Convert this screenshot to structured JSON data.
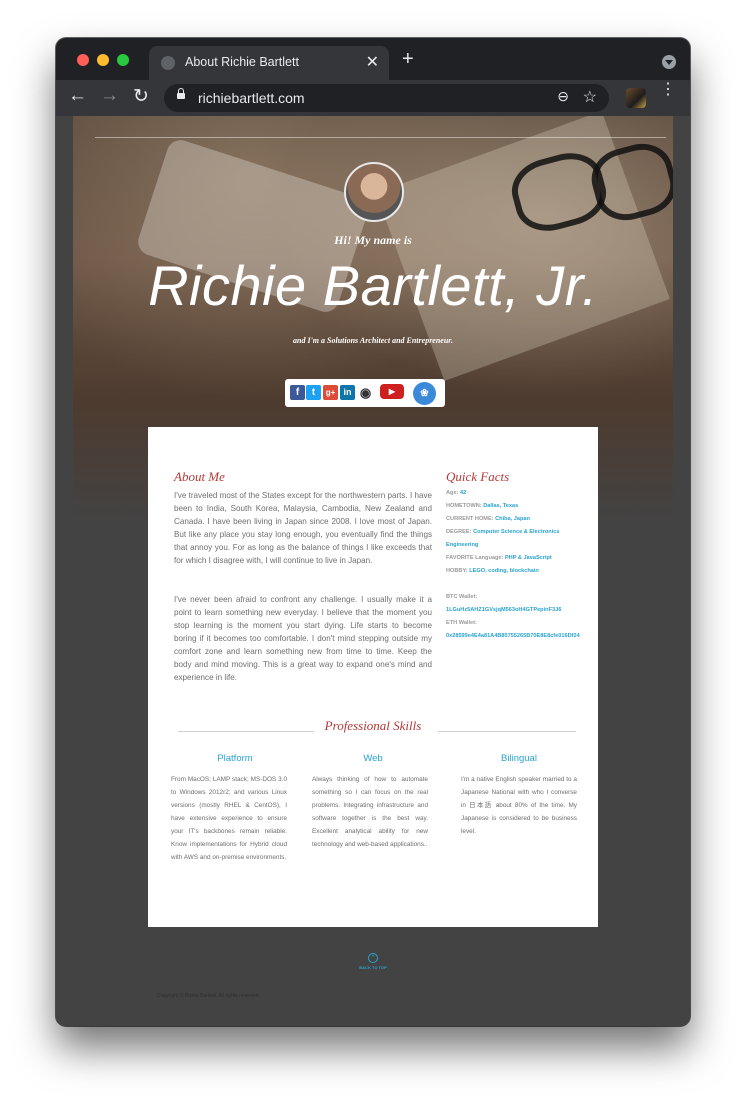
{
  "browser": {
    "tab_title": "About Richie Bartlett",
    "tab_close": "✕",
    "new_tab": "+",
    "url": "richiebartlett.com",
    "nav_back": "←",
    "nav_forward": "→",
    "nav_reload": "↻",
    "zoom_icon": "⊖",
    "star_icon": "☆",
    "menu_icon": "⋮"
  },
  "hero": {
    "greeting": "Hi! My name is",
    "name": "Richie Bartlett, Jr.",
    "tagline": "and I'm a Solutions Architect and Entrepreneur."
  },
  "social": {
    "facebook": "f",
    "twitter": "t",
    "google_plus": "g+",
    "linkedin": "in",
    "github": "◉",
    "youtube": "▶",
    "blockchain": "❀"
  },
  "about": {
    "title": "About Me",
    "paragraphs": [
      "I've traveled most of the States except for the northwestern parts. I have been to India, South Korea, Malaysia, Cambodia, New Zealand and Canada. I have been living in Japan since 2008. I love most of Japan. But like any place you stay long enough, you eventually find the things that annoy you. For as long as the balance of things I like exceeds that for which I disagree with, I will continue to live in Japan.",
      "I've never been afraid to confront any challenge. I usually make it a point to learn something new everyday. I believe that the moment you stop learning is the moment you start dying. Life starts to become boring if it becomes too comfortable. I don't mind stepping outside my comfort zone and learn something new from time to time. Keep the body and mind moving. This is a great way to expand one's mind and experience in life."
    ]
  },
  "facts": {
    "title": "Quick Facts",
    "age_label": "Age:",
    "age_value": "42",
    "hometown_label": "HOMETOWN:",
    "hometown_value": "Dallas, Texas",
    "current_home_label": "CURRENT HOME:",
    "current_home_value": "Chiba, Japan",
    "degree_label": "DEGREE:",
    "degree_value_1": "Computer Science & Electronics",
    "degree_value_2": "Engineering",
    "language_label": "FAVORITE Language:",
    "language_value": "PHP & JavaScript",
    "hobby_label": "HOBBY:",
    "hobby_value": "LEGO, coding, blockchain",
    "btc_label": "BTC Wallet:",
    "btc_value": "1LGuHz5AHZ1GVsjqM563oH4GTPepinF3J6",
    "eth_label": "ETH Wallet:",
    "eth_value": "0x28599e4E4a81A4B85755265B70E8E8cfe016Df24"
  },
  "skills": {
    "title": "Professional Skills",
    "items": [
      {
        "name": "Platform",
        "text": "From MacOS; LAMP stack; MS-DOS 3.0 to Windows 2012r2; and various Linux versions (mostly RHEL & CentOS), I have extensive experience to ensure your IT's backbones remain reliable. Know implementations for Hybrid cloud with AWS and on-premise environments."
      },
      {
        "name": "Web",
        "text": "Always thinking of how to automate something so I can focus on the real problems. Integrating infrastructure and software together is the best way. Excellent analytical ability for new technology and web-based applications.."
      },
      {
        "name": "Bilingual",
        "text": "I'm a native English speaker married to a Japanese National with who I converse in 日本語 about 80% of the time. My Japanese is considered to be business level."
      }
    ]
  },
  "footer": {
    "back_to_top": "BACK TO TOP",
    "back_icon": "^",
    "copyright": "Copyright © Richie Bartlett.  All rights reserved."
  }
}
